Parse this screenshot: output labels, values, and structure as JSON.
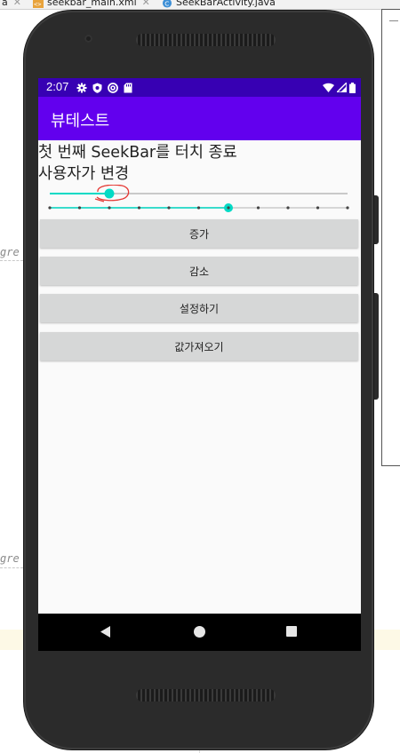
{
  "ide": {
    "tabs": [
      {
        "label": "a",
        "icon": "close-icon"
      },
      {
        "label": "seekbar_main.xml",
        "icon": "xml-file-icon"
      },
      {
        "label": "SeekBarActivity.java",
        "icon": "java-class-icon"
      }
    ],
    "gutter_text_1": "gre",
    "gutter_text_2": "gre"
  },
  "status_bar": {
    "time": "2:07",
    "left_icons": [
      "settings-icon",
      "shield-icon",
      "at-sign-icon",
      "sd-card-icon"
    ],
    "right_icons": [
      "wifi-icon",
      "signal-icon",
      "battery-icon"
    ]
  },
  "app_bar": {
    "title": "뷰테스트",
    "color": "#6200ee",
    "status_color": "#3700b3"
  },
  "content": {
    "line1": "첫 번째 SeekBar를 터치 종료",
    "line2": "사용자가 변경"
  },
  "seekbar1": {
    "progress": 0.2,
    "accent": "#03dac5",
    "annotation": "red-hand-drawn-circle"
  },
  "seekbar2": {
    "max": 10,
    "progress": 6,
    "accent": "#03dac5"
  },
  "buttons": {
    "increase": "증가",
    "decrease": "감소",
    "set": "설정하기",
    "get": "값가져오기"
  },
  "nav": {
    "icons": [
      "back-icon",
      "home-icon",
      "recents-icon"
    ]
  }
}
